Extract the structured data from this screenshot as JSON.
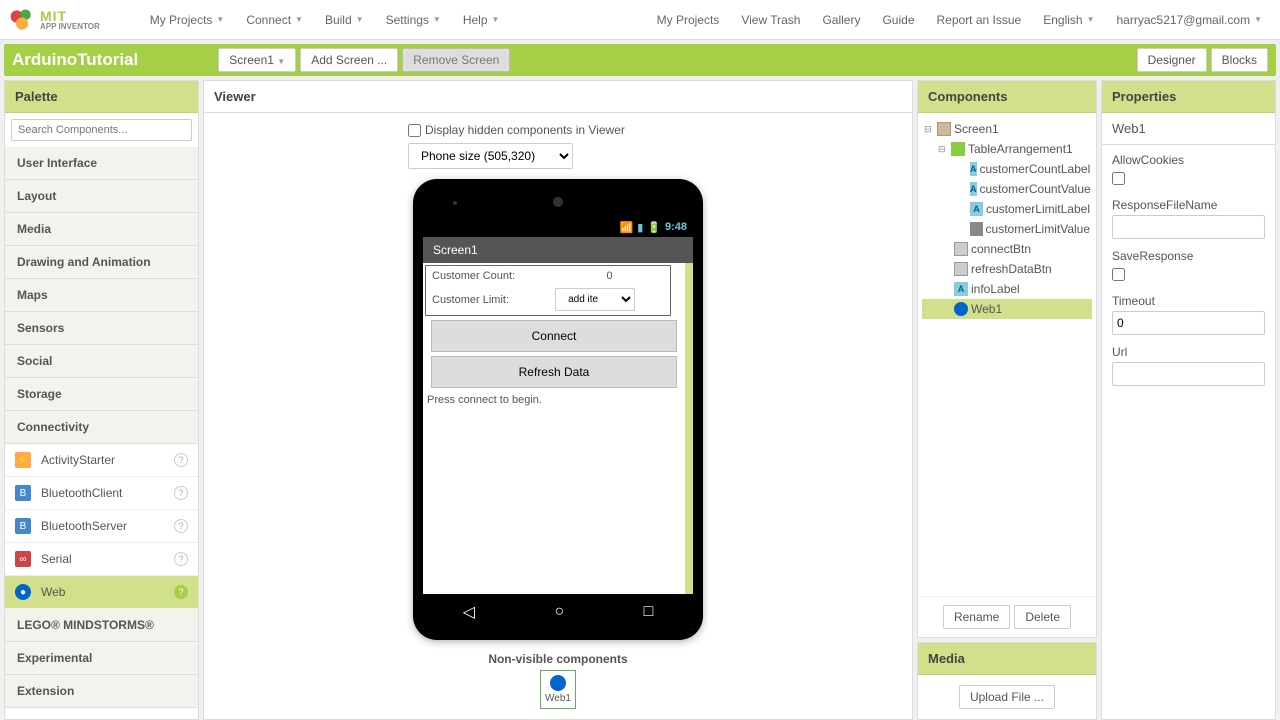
{
  "topbar": {
    "menus_left": [
      "My Projects",
      "Connect",
      "Build",
      "Settings",
      "Help"
    ],
    "menus_right": [
      "My Projects",
      "View Trash",
      "Gallery",
      "Guide",
      "Report an Issue"
    ],
    "language": "English",
    "email": "harryac5217@gmail.com",
    "logo_mit": "MIT",
    "logo_sub": "APP INVENTOR"
  },
  "greenbar": {
    "project": "ArduinoTutorial",
    "screen_btn": "Screen1",
    "add_screen": "Add Screen ...",
    "remove_screen": "Remove Screen",
    "designer": "Designer",
    "blocks": "Blocks"
  },
  "palette": {
    "header": "Palette",
    "search_placeholder": "Search Components...",
    "sections": [
      "User Interface",
      "Layout",
      "Media",
      "Drawing and Animation",
      "Maps",
      "Sensors",
      "Social",
      "Storage",
      "Connectivity"
    ],
    "connectivity_items": [
      "ActivityStarter",
      "BluetoothClient",
      "BluetoothServer",
      "Serial",
      "Web"
    ],
    "sections_after": [
      "LEGO® MINDSTORMS®",
      "Experimental",
      "Extension"
    ]
  },
  "viewer": {
    "header": "Viewer",
    "hidden_label": "Display hidden components in Viewer",
    "phone_size": "Phone size (505,320)",
    "screen_title": "Screen1",
    "status_time": "9:48",
    "customer_count_label": "Customer Count:",
    "customer_count_value": "0",
    "customer_limit_label": "Customer Limit:",
    "spinner_text": "add items ...",
    "connect_btn": "Connect",
    "refresh_btn": "Refresh Data",
    "info_text": "Press connect to begin.",
    "nonvis_header": "Non-visible components",
    "nonvis_item": "Web1"
  },
  "components": {
    "header": "Components",
    "tree": {
      "screen": "Screen1",
      "table": "TableArrangement1",
      "labels": [
        "customerCountLabel",
        "customerCountValue",
        "customerLimitLabel",
        "customerLimitValue"
      ],
      "btns": [
        "connectBtn",
        "refreshDataBtn",
        "infoLabel",
        "Web1"
      ]
    },
    "rename": "Rename",
    "delete": "Delete"
  },
  "media": {
    "header": "Media",
    "upload": "Upload File ..."
  },
  "properties": {
    "header": "Properties",
    "component": "Web1",
    "fields": {
      "allow_cookies": "AllowCookies",
      "response_file": "ResponseFileName",
      "save_response": "SaveResponse",
      "timeout": "Timeout",
      "timeout_value": "0",
      "url": "Url"
    }
  }
}
